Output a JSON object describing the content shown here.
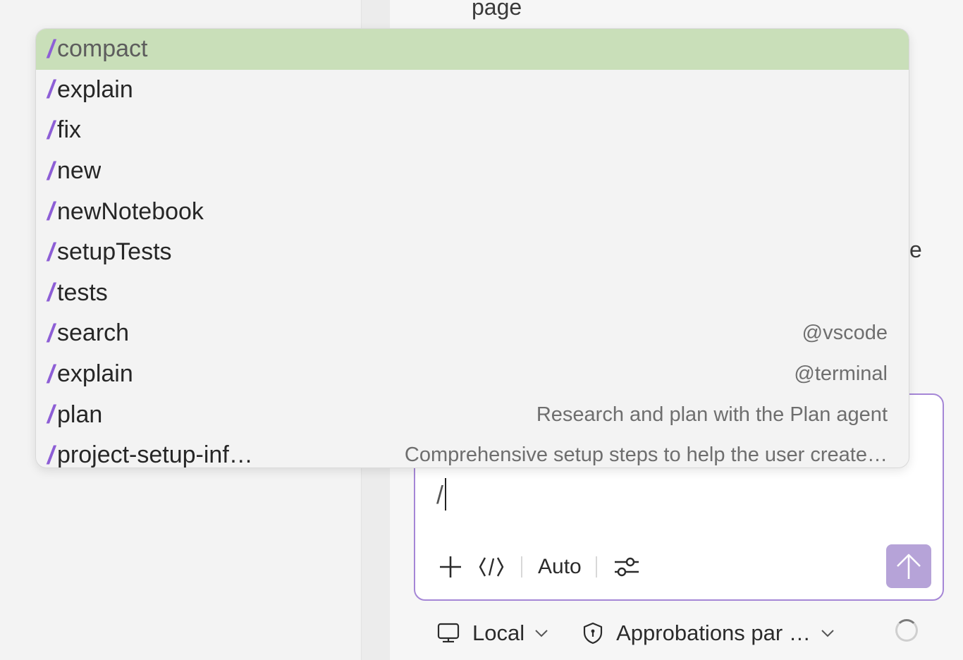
{
  "background": {
    "partial_text_top": "page",
    "partial_text_right": "e"
  },
  "dropdown": {
    "items": [
      {
        "command": "compact",
        "description": "",
        "selected": true
      },
      {
        "command": "explain",
        "description": ""
      },
      {
        "command": "fix",
        "description": ""
      },
      {
        "command": "new",
        "description": ""
      },
      {
        "command": "newNotebook",
        "description": ""
      },
      {
        "command": "setupTests",
        "description": ""
      },
      {
        "command": "tests",
        "description": ""
      },
      {
        "command": "search",
        "description": "@vscode"
      },
      {
        "command": "explain",
        "description": "@terminal"
      },
      {
        "command": "plan",
        "description": "Research and plan with the Plan agent"
      },
      {
        "command": "project-setup-inf…",
        "description": "Comprehensive setup steps to help the user create…"
      }
    ],
    "slash": "/"
  },
  "chat": {
    "input_value": "/",
    "mode_label": "Auto"
  },
  "status_bar": {
    "location_label": "Local",
    "approvals_label": "Approbations par …"
  },
  "colors": {
    "accent": "#8d5ed6",
    "selected_row": "#c9dfb9",
    "card_border": "#a586d6",
    "send_button": "#b6a3d8"
  }
}
